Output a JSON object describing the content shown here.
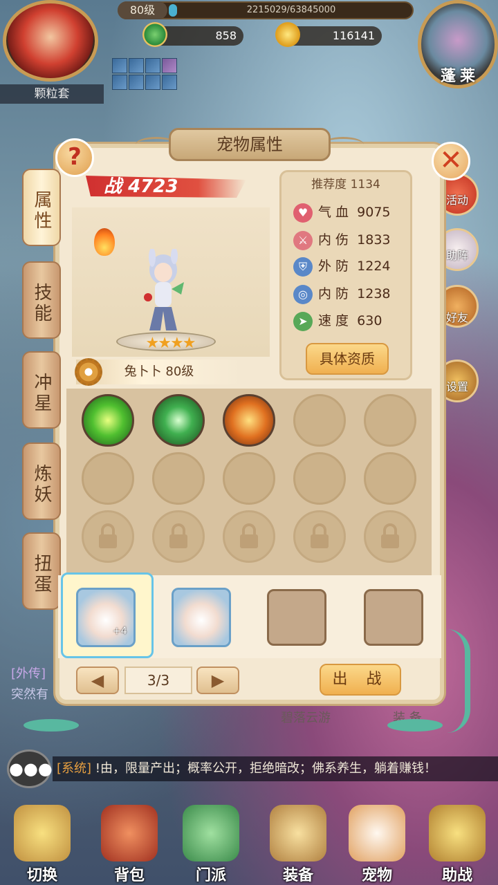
{
  "header": {
    "nickname": "颗粒套",
    "level": "80级",
    "exp_text": "2215029/63845000",
    "exp_fraction": 0.035,
    "currency1": "858",
    "currency2": "116141",
    "map_name": "蓬莱"
  },
  "panel": {
    "title": "宠物属性",
    "help_label": "?",
    "close_label": "✕",
    "side_tabs": [
      "属性",
      "技能",
      "冲星",
      "炼妖",
      "扭蛋"
    ],
    "power_label": "战",
    "power_value": "4723",
    "pet_name": "兔卜卜 80级",
    "stars": "★★★★",
    "recommend_label": "推荐度",
    "recommend_value": "1134",
    "stats": [
      {
        "label": "气 血",
        "value": "9075",
        "color": "#e06070"
      },
      {
        "label": "内 伤",
        "value": "1833",
        "color": "#e07880"
      },
      {
        "label": "外 防",
        "value": "1224",
        "color": "#5a88c8"
      },
      {
        "label": "内 防",
        "value": "1238",
        "color": "#5a88c8"
      },
      {
        "label": "速 度",
        "value": "630",
        "color": "#58a858"
      }
    ],
    "detail_button": "具体资质",
    "page": "3/3",
    "fight_button": "出 战",
    "plus_badge": "+4"
  },
  "behind": {
    "chat_tag": "[外传]",
    "chat_text": "突然有",
    "bottom_left": "碧落云游",
    "bottom_right": "装 备"
  },
  "system_message": {
    "tag": "[系统]",
    "text": "!由，限量产出；概率公开，拒绝暗改；佛系养生，躺着赚钱！"
  },
  "right_menu": [
    "活动",
    "助阵",
    "好友",
    "设置"
  ],
  "bottom_nav": [
    "切换",
    "背包",
    "门派",
    "装备",
    "宠物",
    "助战"
  ]
}
